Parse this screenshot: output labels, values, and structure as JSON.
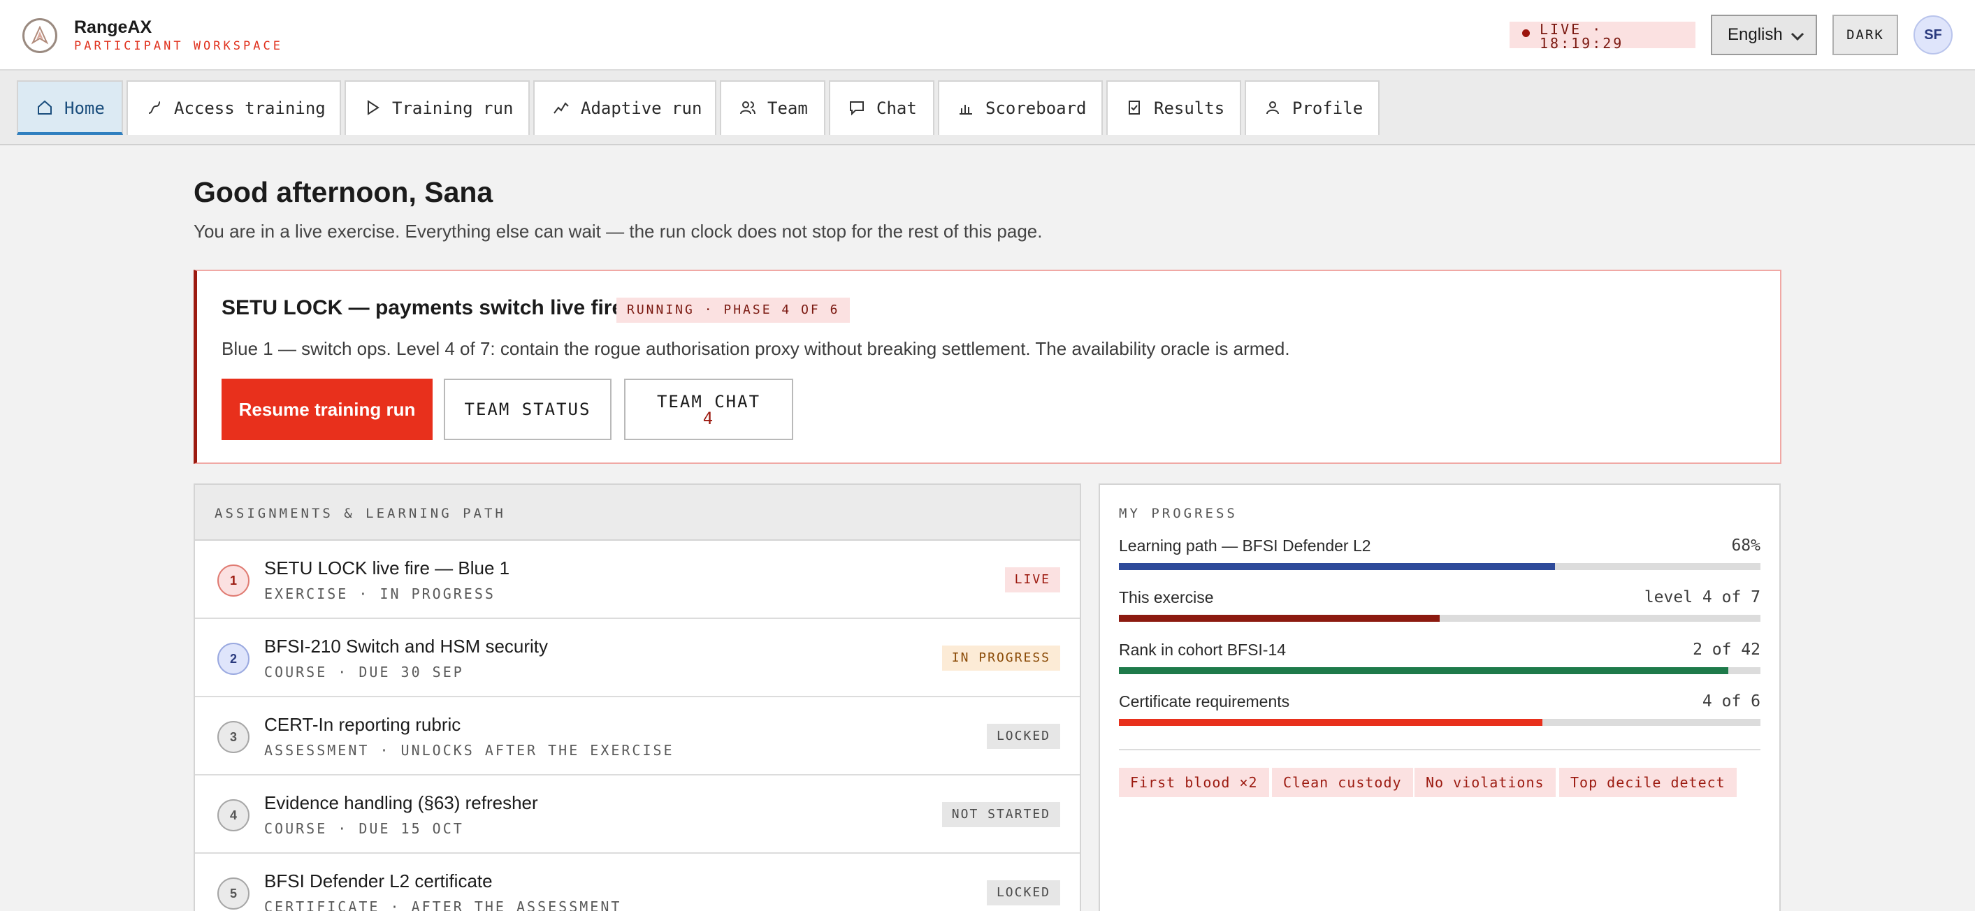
{
  "app": {
    "name": "RangeAX",
    "subtitle": "PARTICIPANT WORKSPACE"
  },
  "header": {
    "live_label": "LIVE ·",
    "live_time": "18:19:29",
    "language": "English",
    "dark_label": "DARK",
    "avatar_initials": "SF"
  },
  "nav": {
    "tabs": [
      {
        "label": "Home",
        "icon": "home-icon",
        "active": true
      },
      {
        "label": "Access training",
        "icon": "route-icon"
      },
      {
        "label": "Training run",
        "icon": "play-icon"
      },
      {
        "label": "Adaptive run",
        "icon": "trend-icon"
      },
      {
        "label": "Team",
        "icon": "users-icon"
      },
      {
        "label": "Chat",
        "icon": "chat-icon"
      },
      {
        "label": "Scoreboard",
        "icon": "bar-chart-icon"
      },
      {
        "label": "Results",
        "icon": "clipboard-check-icon"
      },
      {
        "label": "Profile",
        "icon": "user-icon"
      }
    ]
  },
  "main": {
    "greeting": "Good afternoon, Sana",
    "intro": "You are in a live exercise. Everything else can wait — the run clock does not stop for the rest of this page.",
    "run": {
      "title": "SETU LOCK — payments switch live fire",
      "status": "RUNNING · PHASE 4 OF 6",
      "description": "Blue 1 — switch ops. Level 4 of 7: contain the rogue authorisation proxy without breaking settlement. The availability oracle is armed.",
      "resume_label": "Resume training run",
      "team_status_label": "TEAM STATUS",
      "team_chat_label": "TEAM CHAT",
      "team_chat_count": "4"
    },
    "assignments": {
      "heading": "ASSIGNMENTS & LEARNING PATH",
      "items": [
        {
          "num": "1",
          "title": "SETU LOCK live fire — Blue 1",
          "meta": "EXERCISE · IN PROGRESS",
          "badge": "LIVE"
        },
        {
          "num": "2",
          "title": "BFSI-210 Switch and HSM security",
          "meta": "COURSE · DUE 30 SEP",
          "badge": "IN PROGRESS"
        },
        {
          "num": "3",
          "title": "CERT-In reporting rubric",
          "meta": "ASSESSMENT · UNLOCKS AFTER THE EXERCISE",
          "badge": "LOCKED"
        },
        {
          "num": "4",
          "title": "Evidence handling (§63) refresher",
          "meta": "COURSE · DUE 15 OCT",
          "badge": "NOT STARTED"
        },
        {
          "num": "5",
          "title": "BFSI Defender L2 certificate",
          "meta": "CERTIFICATE · AFTER THE ASSESSMENT",
          "badge": "LOCKED"
        }
      ]
    },
    "progress": {
      "heading": "MY PROGRESS",
      "items": [
        {
          "label": "Learning path — BFSI Defender L2",
          "value": "68%",
          "fraction": 0.68,
          "color": "#2e4a9a"
        },
        {
          "label": "This exercise",
          "value": "level 4 of 7",
          "fraction": 0.5,
          "color": "#8c1a10"
        },
        {
          "label": "Rank in cohort BFSI-14",
          "value": "2 of 42",
          "fraction": 0.95,
          "color": "#1e7a4a"
        },
        {
          "label": "Certificate requirements",
          "value": "4 of 6",
          "fraction": 0.66,
          "color": "#e8301c"
        }
      ],
      "chips": [
        "First blood ×2",
        "Clean custody",
        "No violations",
        "Top decile detect"
      ]
    }
  }
}
